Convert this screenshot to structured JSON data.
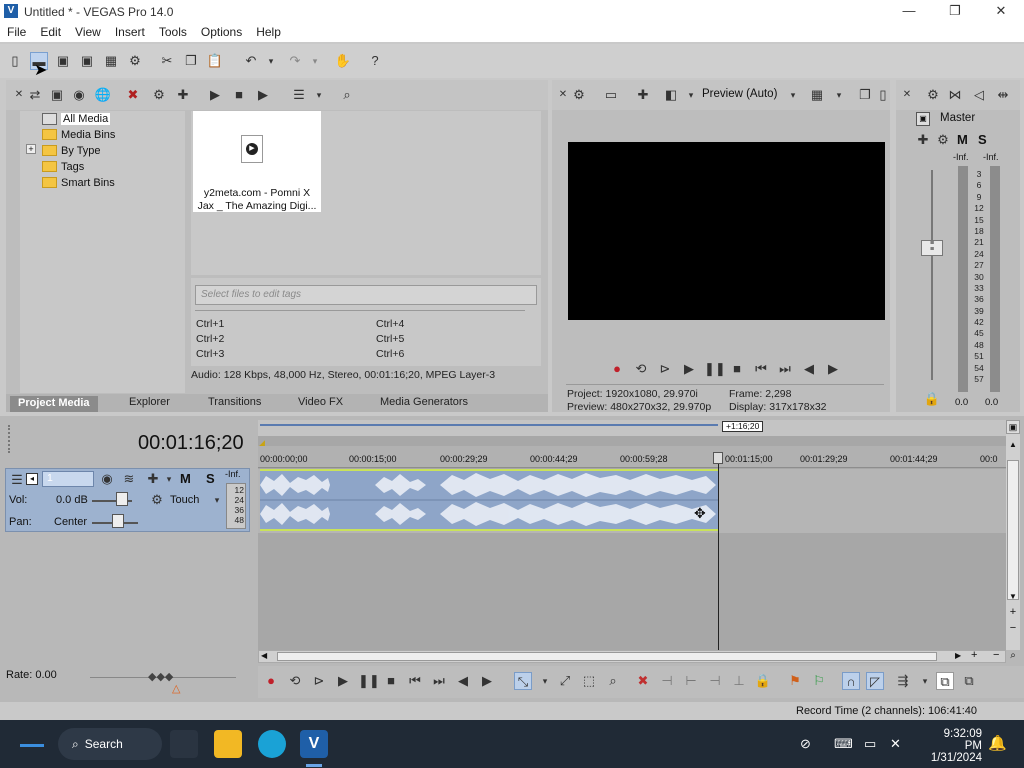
{
  "window": {
    "title": "Untitled * - VEGAS Pro 14.0",
    "logo_glyph": "V",
    "minimize": "—",
    "maximize": "❐",
    "close": "✕"
  },
  "menu": [
    "File",
    "Edit",
    "View",
    "Insert",
    "Tools",
    "Options",
    "Help"
  ],
  "project_media": {
    "tree": [
      {
        "label": "All Media",
        "selected": true
      },
      {
        "label": "Media Bins"
      },
      {
        "label": "By Type",
        "expander": "+"
      },
      {
        "label": "Tags"
      },
      {
        "label": "Smart Bins"
      }
    ],
    "file_name_line1": "y2meta.com - Pomni X",
    "file_name_line2": "Jax _ The Amazing Digi...",
    "tags_placeholder": "Select files to edit tags",
    "shortcuts": [
      "Ctrl+1",
      "Ctrl+4",
      "Ctrl+2",
      "Ctrl+5",
      "Ctrl+3",
      "Ctrl+6"
    ],
    "status": "Audio: 128 Kbps, 48,000 Hz, Stereo, 00:01:16;20, MPEG Layer-3"
  },
  "tabs": [
    "Project Media",
    "Explorer",
    "Transitions",
    "Video FX",
    "Media Generators"
  ],
  "preview": {
    "mode": "Preview (Auto)",
    "project_label": "Project:",
    "project_value": "1920x1080, 29.970i",
    "preview_label": "Preview:",
    "preview_value": "480x270x32, 29.970p",
    "frame_label": "Frame:",
    "frame_value": "2,298",
    "display_label": "Display:",
    "display_value": "317x178x32"
  },
  "master": {
    "label": "Master",
    "m": "M",
    "s": "S",
    "inf_left": "-Inf.",
    "inf_right": "-Inf.",
    "scale": [
      "3",
      "6",
      "9",
      "12",
      "15",
      "18",
      "21",
      "24",
      "27",
      "30",
      "33",
      "36",
      "39",
      "42",
      "45",
      "48",
      "51",
      "54",
      "57"
    ],
    "bottom_left": "0.0",
    "bottom_right": "0.0"
  },
  "timeline": {
    "time": "00:01:16;20",
    "marker_time": "+1:16;20",
    "ruler": [
      "00:00:00;00",
      "00:00:15;00",
      "00:00:29;29",
      "00:00:44;29",
      "00:00:59;28",
      "00:01:15;00",
      "00:01:29;29",
      "00:01:44;29",
      "00:0"
    ],
    "track": {
      "number": "1",
      "m": "M",
      "s": "S",
      "inf": "-Inf.",
      "vol_label": "Vol:",
      "vol_value": "0.0 dB",
      "automation": "Touch",
      "pan_label": "Pan:",
      "pan_value": "Center",
      "meter_scale": [
        "12",
        "24",
        "36",
        "48"
      ]
    },
    "rate": "Rate: 0.00"
  },
  "status_bar": "Record Time (2 channels): 106:41:40",
  "taskbar": {
    "search": "Search",
    "time": "9:32:09 PM",
    "date": "1/31/2024"
  },
  "colors": {
    "clip_fill": "#8ea5c8",
    "clip_edge": "#c9e25a",
    "track_header": "#9db2cf",
    "taskbar": "#202a36"
  }
}
